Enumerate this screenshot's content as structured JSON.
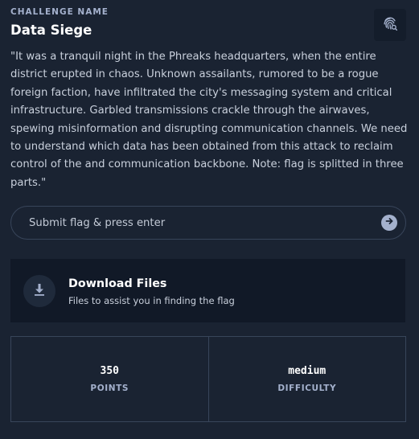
{
  "header": {
    "label": "CHALLENGE NAME",
    "title": "Data Siege",
    "fingerprint_icon": "fingerprint-search-icon"
  },
  "description": "\"It was a tranquil night in the Phreaks headquarters, when the entire district erupted in chaos. Unknown assailants, rumored to be a rogue foreign faction, have infiltrated the city's messaging system and critical infrastructure. Garbled transmissions crackle through the airwaves, spewing misinformation and disrupting communication channels. We need to understand which data has been obtained from this attack to reclaim control of the and communication backbone. Note: flag is splitted in three parts.\"",
  "flag_input": {
    "placeholder": "Submit flag & press enter",
    "value": "",
    "submit_icon": "arrow-right-circle-icon"
  },
  "download": {
    "icon": "download-icon",
    "title": "Download Files",
    "subtitle": "Files to assist you in finding the flag"
  },
  "stats": {
    "points_value": "350",
    "points_label": "POINTS",
    "difficulty_value": "medium",
    "difficulty_label": "DIFFICULTY"
  },
  "colors": {
    "background": "#1a2332",
    "panel": "#111927",
    "border": "#38455a",
    "muted_text": "#a4b1cd",
    "accent_icon": "#a4b1cd"
  }
}
